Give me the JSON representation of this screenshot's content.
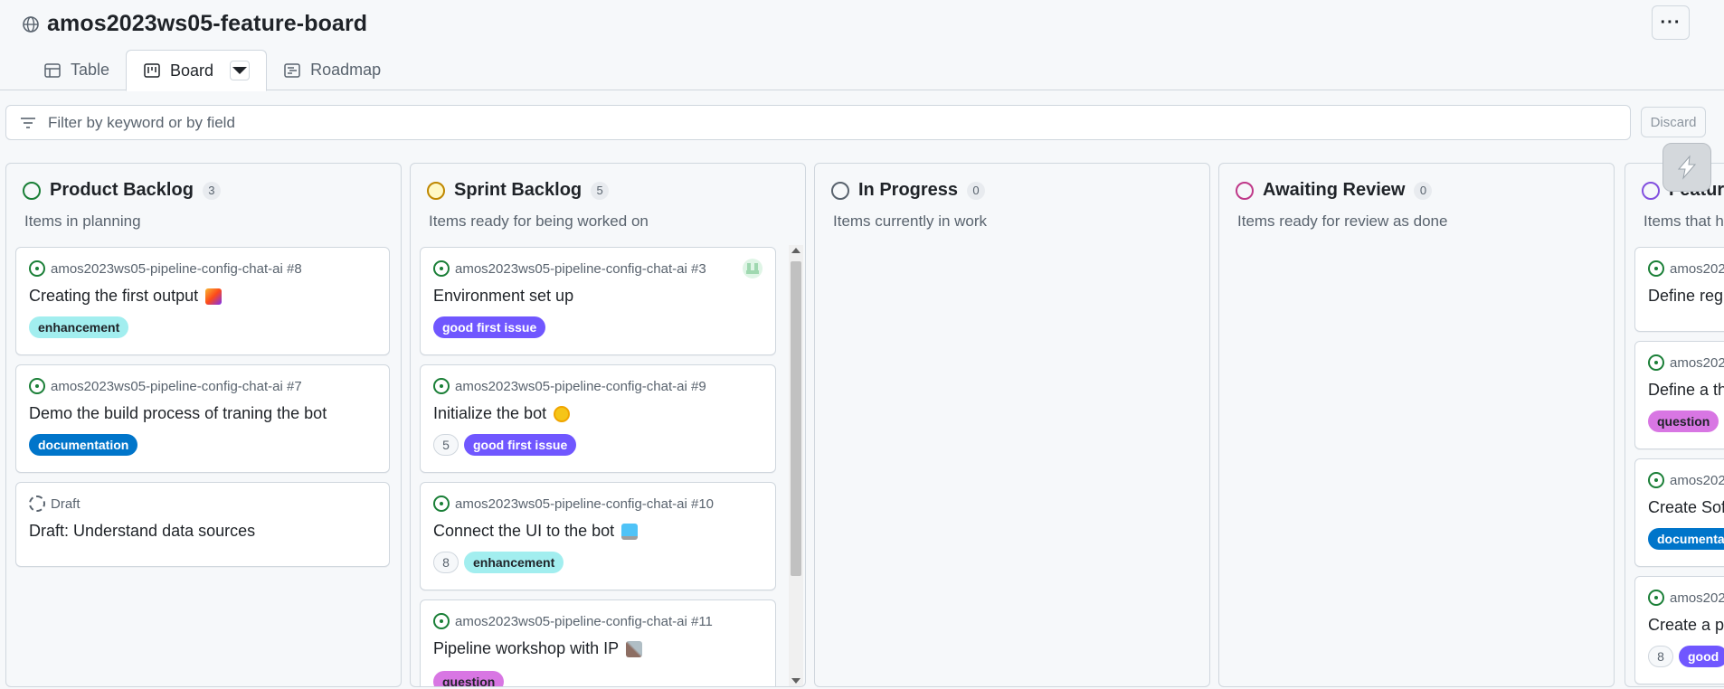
{
  "project": {
    "title": "amos2023ws05-feature-board",
    "more_label": "···"
  },
  "tabs": [
    {
      "label": "Table",
      "icon": "table-icon"
    },
    {
      "label": "Board",
      "icon": "board-icon"
    },
    {
      "label": "Roadmap",
      "icon": "roadmap-icon"
    }
  ],
  "filter": {
    "placeholder": "Filter by keyword or by field",
    "discard_label": "Discard"
  },
  "colors": {
    "enhancement": "#a2eeef",
    "documentation": "#0075ca",
    "good_first_issue": "#7057ff",
    "question": "#d876e3",
    "backlog_dot": "#1a7f37",
    "sprint_dot": "#bf8700",
    "progress_dot": "#59636e",
    "review_dot": "#bf3989",
    "feature_dot": "#8250df"
  },
  "columns": [
    {
      "name": "Product Backlog",
      "count": "3",
      "description": "Items in planning",
      "cards": [
        {
          "ref": "amos2023ws05-pipeline-config-chat-ai #8",
          "title": "Creating the first output",
          "emoji": "party-popper-icon",
          "labels": [
            "enhancement"
          ]
        },
        {
          "ref": "amos2023ws05-pipeline-config-chat-ai #7",
          "title": "Demo the build process of traning the bot",
          "labels": [
            "documentation"
          ]
        },
        {
          "ref": "Draft",
          "title": "Draft: Understand data sources",
          "draft": true,
          "labels": []
        }
      ]
    },
    {
      "name": "Sprint Backlog",
      "count": "5",
      "description": "Items ready for being worked on",
      "cards": [
        {
          "ref": "amos2023ws05-pipeline-config-chat-ai #3",
          "title": "Environment set up",
          "labels": [
            "good first issue"
          ],
          "avatar": "avatar"
        },
        {
          "ref": "amos2023ws05-pipeline-config-chat-ai #9",
          "title": "Initialize the bot",
          "emoji": "sun-icon",
          "estimate": "5",
          "labels": [
            "good first issue"
          ]
        },
        {
          "ref": "amos2023ws05-pipeline-config-chat-ai #10",
          "title": "Connect the UI to the bot",
          "emoji": "computer-icon",
          "estimate": "8",
          "labels": [
            "enhancement"
          ]
        },
        {
          "ref": "amos2023ws05-pipeline-config-chat-ai #11",
          "title": "Pipeline workshop with IP",
          "emoji": "hammer-wrench-icon",
          "labels": [
            "question"
          ]
        }
      ]
    },
    {
      "name": "In Progress",
      "count": "0",
      "description": "Items currently in work",
      "cards": []
    },
    {
      "name": "Awaiting Review",
      "count": "0",
      "description": "Items ready for review as done",
      "cards": []
    },
    {
      "name": "Featur",
      "description": "Items that h",
      "cards": [
        {
          "ref": "amos202",
          "title": "Define regu",
          "labels": []
        },
        {
          "ref": "amos202",
          "title": "Define a th",
          "labels": [
            "question"
          ]
        },
        {
          "ref": "amos202",
          "title": "Create Sof",
          "labels": [
            "documenta"
          ]
        },
        {
          "ref": "amos202",
          "title": "Create a pr",
          "estimate": "8",
          "labels": [
            "good"
          ]
        }
      ]
    }
  ]
}
